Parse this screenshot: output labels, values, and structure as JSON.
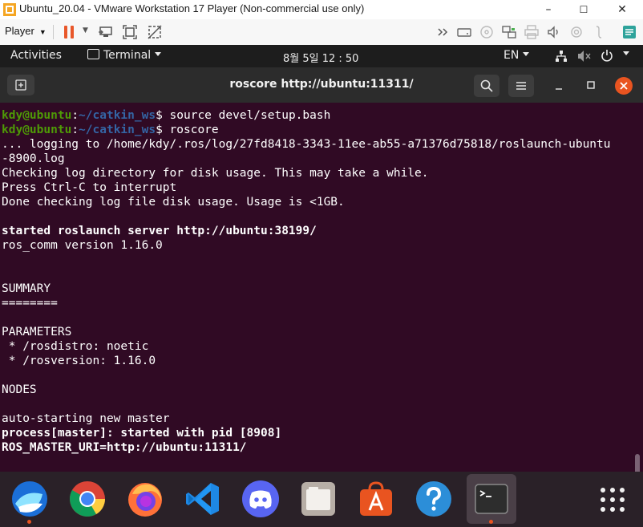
{
  "vmware": {
    "window_title": "Ubuntu_20.04 - VMware Workstation 17 Player (Non-commercial use only)",
    "player_menu": "Player",
    "window_controls": {
      "minimize": "–",
      "maximize": "☐",
      "close": "✕"
    }
  },
  "topbar": {
    "activities": "Activities",
    "app_menu": "Terminal",
    "clock": "8월 5일  12 : 50",
    "language": "EN"
  },
  "terminal": {
    "title": "roscore http://ubuntu:11311/",
    "lines": [
      {
        "user": "kdy@ubuntu",
        "sep": ":",
        "path": "~/catkin_ws",
        "cmd": "$ source devel/setup.bash"
      },
      {
        "user": "kdy@ubuntu",
        "sep": ":",
        "path": "~/catkin_ws",
        "cmd": "$ roscore"
      },
      {
        "text": "... logging to /home/kdy/.ros/log/27fd8418-3343-11ee-ab55-a71376d75818/roslaunch-ubuntu"
      },
      {
        "text": "-8900.log"
      },
      {
        "text": "Checking log directory for disk usage. This may take a while."
      },
      {
        "text": "Press Ctrl-C to interrupt"
      },
      {
        "text": "Done checking log file disk usage. Usage is <1GB."
      },
      {
        "text": ""
      },
      {
        "text": "started roslaunch server http://ubuntu:38199/",
        "bold": true
      },
      {
        "text": "ros_comm version 1.16.0"
      },
      {
        "text": ""
      },
      {
        "text": ""
      },
      {
        "text": "SUMMARY"
      },
      {
        "text": "========"
      },
      {
        "text": ""
      },
      {
        "text": "PARAMETERS"
      },
      {
        "text": " * /rosdistro: noetic"
      },
      {
        "text": " * /rosversion: 1.16.0"
      },
      {
        "text": ""
      },
      {
        "text": "NODES"
      },
      {
        "text": ""
      },
      {
        "text": "auto-starting new master"
      },
      {
        "text": "process[master]: started with pid [8908]",
        "bold": true
      },
      {
        "text": "ROS_MASTER_URI=http://ubuntu:11311/",
        "bold": true
      }
    ]
  },
  "dock": {
    "items": [
      "whale-browser",
      "chrome",
      "firefox",
      "vscode",
      "discord",
      "files",
      "ubuntu-software",
      "help",
      "terminal",
      "show-applications"
    ]
  }
}
